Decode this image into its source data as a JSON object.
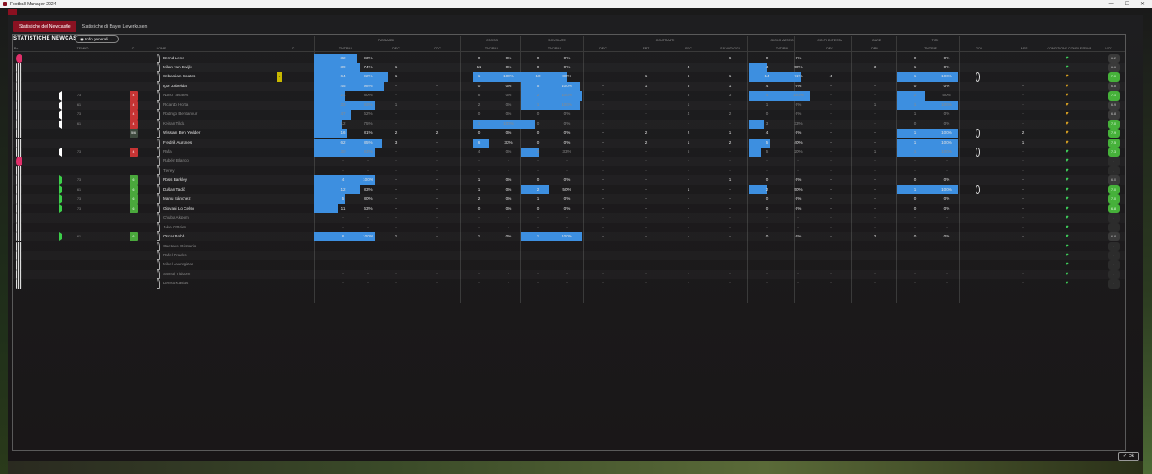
{
  "window": {
    "title": "Football Manager 2024"
  },
  "tabs": [
    {
      "label": "Statistiche del Newcastle",
      "active": true
    },
    {
      "label": "Statistiche di Bayer Leverkusen",
      "active": false
    }
  ],
  "panel": {
    "title": "STATISTICHE NEWCASTLE",
    "view_button": "Info generali"
  },
  "column_groups": {
    "passaggi": "PASSAGGI",
    "cross": "CROSS",
    "scivolate": "SCIVOLATE",
    "contrasti": "CONTRASTI",
    "gioco_aereo": "GIOCO AEREO",
    "colpi_testa": "COLPI DI TESTA",
    "gare": "GARE",
    "tiri": "TIRI"
  },
  "columns": {
    "pos": "Po",
    "tempo": "TEMPO",
    "c_left": "C",
    "nome": "NOME",
    "c_right": "C",
    "pass_tnt": "TNT/RIU",
    "pass_dec": "DEC",
    "pass_occ": "OCC",
    "cross_tnt": "TNT/RIU",
    "sciv_tnt": "TNT/RIU",
    "contr_dec": "DEC",
    "contr_fpt": "FPT",
    "contr_rec": "REC",
    "salvataggi": "SALVATAGGI",
    "aereo_tnt": "TNT/RIU",
    "testa_dec": "DEC",
    "drib": "DRB",
    "tiri_tnt": "TNT/RIF",
    "gol": "GOL",
    "ass": "ASS",
    "condizione": "CONDIZIONE COMPLESSIVA",
    "voto": "VOT"
  },
  "players": [
    {
      "name": "Bernd Leno",
      "gk": true,
      "dim": false,
      "sub": "",
      "min": "",
      "card": "",
      "cardc": "",
      "yel": false,
      "p1": "32",
      "p2": "93%",
      "pb": 28,
      "pdec": "-",
      "pocc": "-",
      "c1": "0",
      "c2": "0%",
      "cb": 0,
      "s1": "0",
      "s2": "0%",
      "sb": 0,
      "tdec": "-",
      "tfpt": "-",
      "trec": "-",
      "salv": "6",
      "a1": "0",
      "a2": "0%",
      "ab": 0,
      "hdec": "-",
      "drb": "-",
      "t1": "0",
      "t2": "0%",
      "tb": 0,
      "gol": "",
      "ass": "-",
      "cond": "green",
      "vot": "6.2",
      "votc": "grey"
    },
    {
      "name": "Milan van Ewijk",
      "gk": false,
      "dim": false,
      "sub": "",
      "min": "",
      "card": "",
      "cardc": "",
      "yel": false,
      "p1": "39",
      "p2": "74%",
      "pb": 30,
      "pdec": "1",
      "pocc": "-",
      "c1": "11",
      "c2": "0%",
      "cb": 0,
      "s1": "0",
      "s2": "0%",
      "sb": 0,
      "tdec": "-",
      "tfpt": "-",
      "trec": "4",
      "salv": "-",
      "a1": "4",
      "a2": "50%",
      "ab": 12,
      "hdec": "-",
      "drb": "3",
      "t1": "1",
      "t2": "0%",
      "tb": 0,
      "gol": "",
      "ass": "-",
      "cond": "green",
      "vot": "6.6",
      "votc": "grey"
    },
    {
      "name": "Sebastian Coates",
      "gk": false,
      "dim": false,
      "sub": "",
      "min": "",
      "card": "",
      "cardc": "",
      "yel": true,
      "p1": "64",
      "p2": "92%",
      "pb": 48,
      "pdec": "1",
      "pocc": "-",
      "c1": "1",
      "c2": "100%",
      "cb": 40,
      "s1": "10",
      "s2": "80%",
      "sb": 30,
      "tdec": "-",
      "tfpt": "1",
      "trec": "6",
      "salv": "1",
      "a1": "14",
      "a2": "71%",
      "ab": 34,
      "hdec": "4",
      "drb": "-",
      "t1": "1",
      "t2": "100%",
      "tb": 40,
      "gol": "1",
      "ass": "-",
      "cond": "orange",
      "vot": "7.0",
      "votc": "green"
    },
    {
      "name": "Igor Zubeldia",
      "gk": false,
      "dim": false,
      "sub": "",
      "min": "",
      "card": "",
      "cardc": "",
      "yel": false,
      "p1": "45",
      "p2": "98%",
      "pb": 46,
      "pdec": "-",
      "pocc": "-",
      "c1": "0",
      "c2": "0%",
      "cb": 0,
      "s1": "5",
      "s2": "100%",
      "sb": 38,
      "tdec": "-",
      "tfpt": "1",
      "trec": "5",
      "salv": "1",
      "a1": "4",
      "a2": "0%",
      "ab": 0,
      "hdec": "-",
      "drb": "-",
      "t1": "0",
      "t2": "0%",
      "tb": 0,
      "gol": "",
      "ass": "-",
      "cond": "orange",
      "vot": "6.8",
      "votc": "grey"
    },
    {
      "name": "Nuno Tavares",
      "gk": false,
      "dim": true,
      "sub": "out",
      "min": "73",
      "card": "4",
      "cardc": "red",
      "yel": false,
      "p1": "21",
      "p2": "80%",
      "pb": 20,
      "pdec": "-",
      "pocc": "-",
      "c1": "8",
      "c2": "0%",
      "cb": 0,
      "s1": "2",
      "s2": "100%",
      "sb": 40,
      "tdec": "-",
      "tfpt": "-",
      "trec": "3",
      "salv": "3",
      "a1": "4",
      "a2": "100%",
      "ab": 40,
      "hdec": "-",
      "drb": "-",
      "t1": "2",
      "t2": "50%",
      "tb": 18,
      "gol": "",
      "ass": "-",
      "cond": "orange",
      "vot": "7.1",
      "votc": "green"
    },
    {
      "name": "Ricardo Horta",
      "gk": false,
      "dim": true,
      "sub": "out",
      "min": "61",
      "card": "4",
      "cardc": "red",
      "yel": false,
      "p1": "33",
      "p2": "93%",
      "pb": 40,
      "pdec": "1",
      "pocc": "-",
      "c1": "2",
      "c2": "0%",
      "cb": 0,
      "s1": "1",
      "s2": "100%",
      "sb": 38,
      "tdec": "-",
      "tfpt": "-",
      "trec": "1",
      "salv": "-",
      "a1": "1",
      "a2": "0%",
      "ab": 0,
      "hdec": "-",
      "drb": "1",
      "t1": "1",
      "t2": "100%",
      "tb": 40,
      "gol": "",
      "ass": "-",
      "cond": "orange",
      "vot": "6.9",
      "votc": "grey"
    },
    {
      "name": "Rodrigo Bentancur",
      "gk": false,
      "dim": true,
      "sub": "out",
      "min": "73",
      "card": "4",
      "cardc": "red",
      "yel": false,
      "p1": "47",
      "p2": "62%",
      "pb": 24,
      "pdec": "-",
      "pocc": "-",
      "c1": "0",
      "c2": "0%",
      "cb": 0,
      "s1": "0",
      "s2": "0%",
      "sb": 0,
      "tdec": "-",
      "tfpt": "-",
      "trec": "4",
      "salv": "2",
      "a1": "0",
      "a2": "0%",
      "ab": 0,
      "hdec": "-",
      "drb": "-",
      "t1": "1",
      "t2": "0%",
      "tb": 0,
      "gol": "",
      "ass": "-",
      "cond": "orange",
      "vot": "6.8",
      "votc": "grey"
    },
    {
      "name": "Keiran Tilda",
      "gk": false,
      "dim": true,
      "sub": "out",
      "min": "61",
      "card": "4",
      "cardc": "red",
      "yel": false,
      "p1": "12",
      "p2": "75%",
      "pb": 18,
      "pdec": "-",
      "pocc": "-",
      "c1": "1",
      "c2": "100%",
      "cb": 40,
      "s1": "0",
      "s2": "0%",
      "sb": 0,
      "tdec": "-",
      "tfpt": "-",
      "trec": "-",
      "salv": "-",
      "a1": "3",
      "a2": "33%",
      "ab": 10,
      "hdec": "-",
      "drb": "-",
      "t1": "0",
      "t2": "0%",
      "tb": 0,
      "gol": "",
      "ass": "-",
      "cond": "orange",
      "vot": "7.0",
      "votc": "green"
    },
    {
      "name": "Wissam Ben Yedder",
      "gk": false,
      "dim": false,
      "sub": "",
      "min": "",
      "card": "5/6",
      "cardc": "grey",
      "yel": false,
      "p1": "16",
      "p2": "81%",
      "pb": 22,
      "pdec": "2",
      "pocc": "2",
      "c1": "0",
      "c2": "0%",
      "cb": 0,
      "s1": "0",
      "s2": "0%",
      "sb": 0,
      "tdec": "-",
      "tfpt": "2",
      "trec": "2",
      "salv": "1",
      "a1": "4",
      "a2": "0%",
      "ab": 0,
      "hdec": "-",
      "drb": "-",
      "t1": "1",
      "t2": "100%",
      "tb": 40,
      "gol": "1",
      "ass": "2",
      "cond": "orange",
      "vot": "7.9",
      "votc": "green"
    },
    {
      "name": "Fredrik Aursnes",
      "gk": false,
      "dim": false,
      "sub": "",
      "min": "",
      "card": "",
      "cardc": "",
      "yel": false,
      "p1": "62",
      "p2": "85%",
      "pb": 44,
      "pdec": "3",
      "pocc": "-",
      "c1": "6",
      "c2": "33%",
      "cb": 10,
      "s1": "0",
      "s2": "0%",
      "sb": 0,
      "tdec": "-",
      "tfpt": "2",
      "trec": "1",
      "salv": "2",
      "a1": "5",
      "a2": "40%",
      "ab": 14,
      "hdec": "-",
      "drb": "-",
      "t1": "1",
      "t2": "100%",
      "tb": 40,
      "gol": "",
      "ass": "1",
      "cond": "orange",
      "vot": "7.5",
      "votc": "green"
    },
    {
      "name": "Rafa",
      "gk": false,
      "dim": true,
      "sub": "out",
      "min": "73",
      "card": "4",
      "cardc": "red",
      "yel": false,
      "p1": "30",
      "p2": "93%",
      "pb": 40,
      "pdec": "-",
      "pocc": "-",
      "c1": "4",
      "c2": "0%",
      "cb": 0,
      "s1": "3",
      "s2": "33%",
      "sb": 12,
      "tdec": "-",
      "tfpt": "-",
      "trec": "6",
      "salv": "-",
      "a1": "5",
      "a2": "20%",
      "ab": 8,
      "hdec": "-",
      "drb": "1",
      "t1": "1",
      "t2": "100%",
      "tb": 40,
      "gol": "1",
      "ass": "-",
      "cond": "green",
      "vot": "7.3",
      "votc": "green"
    },
    {
      "name": "Rubén Blanco",
      "gk": true,
      "dim": true,
      "sub": "",
      "min": "",
      "card": "",
      "cardc": "",
      "yel": false,
      "p1": "-",
      "p2": "-",
      "pb": 0,
      "pdec": "-",
      "pocc": "-",
      "c1": "-",
      "c2": "-",
      "cb": 0,
      "s1": "-",
      "s2": "-",
      "sb": 0,
      "tdec": "-",
      "tfpt": "-",
      "trec": "-",
      "salv": "-",
      "a1": "-",
      "a2": "-",
      "ab": 0,
      "hdec": "-",
      "drb": "-",
      "t1": "-",
      "t2": "-",
      "tb": 0,
      "gol": "",
      "ass": "-",
      "cond": "green",
      "vot": "-",
      "votc": "empty"
    },
    {
      "name": "Tierey",
      "gk": false,
      "dim": true,
      "sub": "",
      "min": "",
      "card": "",
      "cardc": "",
      "yel": false,
      "p1": "-",
      "p2": "-",
      "pb": 0,
      "pdec": "-",
      "pocc": "-",
      "c1": "-",
      "c2": "-",
      "cb": 0,
      "s1": "-",
      "s2": "-",
      "sb": 0,
      "tdec": "-",
      "tfpt": "-",
      "trec": "-",
      "salv": "-",
      "a1": "-",
      "a2": "-",
      "ab": 0,
      "hdec": "-",
      "drb": "-",
      "t1": "-",
      "t2": "-",
      "tb": 0,
      "gol": "",
      "ass": "-",
      "cond": "green",
      "vot": "-",
      "votc": "empty"
    },
    {
      "name": "Ross Barkley",
      "gk": false,
      "dim": false,
      "sub": "in",
      "min": "73",
      "card": "6",
      "cardc": "green",
      "yel": false,
      "p1": "4",
      "p2": "100%",
      "pb": 40,
      "pdec": "-",
      "pocc": "-",
      "c1": "1",
      "c2": "0%",
      "cb": 0,
      "s1": "0",
      "s2": "0%",
      "sb": 0,
      "tdec": "-",
      "tfpt": "-",
      "trec": "-",
      "salv": "1",
      "a1": "0",
      "a2": "0%",
      "ab": 0,
      "hdec": "-",
      "drb": "-",
      "t1": "0",
      "t2": "0%",
      "tb": 0,
      "gol": "",
      "ass": "-",
      "cond": "green",
      "vot": "6.0",
      "votc": "grey"
    },
    {
      "name": "Dušan Tadić",
      "gk": false,
      "dim": false,
      "sub": "in",
      "min": "61",
      "card": "6",
      "cardc": "green",
      "yel": false,
      "p1": "12",
      "p2": "83%",
      "pb": 30,
      "pdec": "-",
      "pocc": "-",
      "c1": "1",
      "c2": "0%",
      "cb": 0,
      "s1": "2",
      "s2": "50%",
      "sb": 18,
      "tdec": "-",
      "tfpt": "-",
      "trec": "1",
      "salv": "-",
      "a1": "2",
      "a2": "50%",
      "ab": 12,
      "hdec": "-",
      "drb": "-",
      "t1": "1",
      "t2": "100%",
      "tb": 40,
      "gol": "1",
      "ass": "-",
      "cond": "green",
      "vot": "7.0",
      "votc": "green"
    },
    {
      "name": "Manu Sánchez",
      "gk": false,
      "dim": false,
      "sub": "in",
      "min": "73",
      "card": "6",
      "cardc": "green",
      "yel": false,
      "p1": "5",
      "p2": "80%",
      "pb": 20,
      "pdec": "-",
      "pocc": "-",
      "c1": "2",
      "c2": "0%",
      "cb": 0,
      "s1": "1",
      "s2": "0%",
      "sb": 0,
      "tdec": "-",
      "tfpt": "-",
      "trec": "-",
      "salv": "-",
      "a1": "0",
      "a2": "0%",
      "ab": 0,
      "hdec": "-",
      "drb": "-",
      "t1": "0",
      "t2": "0%",
      "tb": 0,
      "gol": "",
      "ass": "-",
      "cond": "green",
      "vot": "7.0",
      "votc": "green"
    },
    {
      "name": "Giovani Lo Celso",
      "gk": false,
      "dim": false,
      "sub": "in",
      "min": "73",
      "card": "6",
      "cardc": "green",
      "yel": false,
      "p1": "11",
      "p2": "63%",
      "pb": 16,
      "pdec": "-",
      "pocc": "-",
      "c1": "0",
      "c2": "0%",
      "cb": 0,
      "s1": "0",
      "s2": "0%",
      "sb": 0,
      "tdec": "-",
      "tfpt": "-",
      "trec": "-",
      "salv": "-",
      "a1": "0",
      "a2": "0%",
      "ab": 0,
      "hdec": "-",
      "drb": "-",
      "t1": "0",
      "t2": "0%",
      "tb": 0,
      "gol": "",
      "ass": "-",
      "cond": "green",
      "vot": "6.8",
      "votc": "green"
    },
    {
      "name": "Chuba Akpom",
      "gk": false,
      "dim": true,
      "sub": "",
      "min": "",
      "card": "",
      "cardc": "",
      "yel": false,
      "p1": "-",
      "p2": "-",
      "pb": 0,
      "pdec": "-",
      "pocc": "-",
      "c1": "-",
      "c2": "-",
      "cb": 0,
      "s1": "-",
      "s2": "-",
      "sb": 0,
      "tdec": "-",
      "tfpt": "-",
      "trec": "-",
      "salv": "-",
      "a1": "-",
      "a2": "-",
      "ab": 0,
      "hdec": "-",
      "drb": "-",
      "t1": "-",
      "t2": "-",
      "tb": 0,
      "gol": "",
      "ass": "-",
      "cond": "green",
      "vot": "-",
      "votc": "empty"
    },
    {
      "name": "Jake O'Brien",
      "gk": false,
      "dim": true,
      "sub": "",
      "min": "",
      "card": "",
      "cardc": "",
      "yel": false,
      "p1": "-",
      "p2": "-",
      "pb": 0,
      "pdec": "-",
      "pocc": "-",
      "c1": "-",
      "c2": "-",
      "cb": 0,
      "s1": "-",
      "s2": "-",
      "sb": 0,
      "tdec": "-",
      "tfpt": "-",
      "trec": "-",
      "salv": "-",
      "a1": "-",
      "a2": "-",
      "ab": 0,
      "hdec": "-",
      "drb": "-",
      "t1": "-",
      "t2": "-",
      "tb": 0,
      "gol": "",
      "ass": "-",
      "cond": "green",
      "vot": "-",
      "votc": "empty"
    },
    {
      "name": "Oscar Bobb",
      "gk": false,
      "dim": false,
      "sub": "in",
      "min": "61",
      "card": "6",
      "cardc": "green",
      "yel": false,
      "p1": "6",
      "p2": "100%",
      "pb": 40,
      "pdec": "1",
      "pocc": "-",
      "c1": "1",
      "c2": "0%",
      "cb": 0,
      "s1": "1",
      "s2": "100%",
      "sb": 40,
      "tdec": "-",
      "tfpt": "-",
      "trec": "-",
      "salv": "-",
      "a1": "0",
      "a2": "0%",
      "ab": 0,
      "hdec": "-",
      "drb": "2",
      "t1": "0",
      "t2": "0%",
      "tb": 0,
      "gol": "",
      "ass": "-",
      "cond": "green",
      "vot": "6.8",
      "votc": "grey"
    },
    {
      "name": "Gaetano Oristanio",
      "gk": false,
      "dim": true,
      "sub": "",
      "min": "",
      "card": "",
      "cardc": "",
      "yel": false,
      "p1": "-",
      "p2": "-",
      "pb": 0,
      "pdec": "-",
      "pocc": "-",
      "c1": "-",
      "c2": "-",
      "cb": 0,
      "s1": "-",
      "s2": "-",
      "sb": 0,
      "tdec": "-",
      "tfpt": "-",
      "trec": "-",
      "salv": "-",
      "a1": "-",
      "a2": "-",
      "ab": 0,
      "hdec": "-",
      "drb": "-",
      "t1": "-",
      "t2": "-",
      "tb": 0,
      "gol": "",
      "ass": "-",
      "cond": "green",
      "vot": "-",
      "votc": "empty"
    },
    {
      "name": "Rafel Prados",
      "gk": false,
      "dim": true,
      "sub": "",
      "min": "",
      "card": "",
      "cardc": "",
      "yel": false,
      "p1": "-",
      "p2": "-",
      "pb": 0,
      "pdec": "-",
      "pocc": "-",
      "c1": "-",
      "c2": "-",
      "cb": 0,
      "s1": "-",
      "s2": "-",
      "sb": 0,
      "tdec": "-",
      "tfpt": "-",
      "trec": "-",
      "salv": "-",
      "a1": "-",
      "a2": "-",
      "ab": 0,
      "hdec": "-",
      "drb": "-",
      "t1": "-",
      "t2": "-",
      "tb": 0,
      "gol": "",
      "ass": "-",
      "cond": "green",
      "vot": "-",
      "votc": "empty"
    },
    {
      "name": "Mikel Jauregizar",
      "gk": false,
      "dim": true,
      "sub": "",
      "min": "",
      "card": "",
      "cardc": "",
      "yel": false,
      "p1": "-",
      "p2": "-",
      "pb": 0,
      "pdec": "-",
      "pocc": "-",
      "c1": "-",
      "c2": "-",
      "cb": 0,
      "s1": "-",
      "s2": "-",
      "sb": 0,
      "tdec": "-",
      "tfpt": "-",
      "trec": "-",
      "salv": "-",
      "a1": "-",
      "a2": "-",
      "ab": 0,
      "hdec": "-",
      "drb": "-",
      "t1": "-",
      "t2": "-",
      "tb": 0,
      "gol": "",
      "ass": "-",
      "cond": "green",
      "vot": "-",
      "votc": "empty"
    },
    {
      "name": "Samuij Tiddom",
      "gk": false,
      "dim": true,
      "sub": "",
      "min": "",
      "card": "",
      "cardc": "",
      "yel": false,
      "p1": "-",
      "p2": "-",
      "pb": 0,
      "pdec": "-",
      "pocc": "-",
      "c1": "-",
      "c2": "-",
      "cb": 0,
      "s1": "-",
      "s2": "-",
      "sb": 0,
      "tdec": "-",
      "tfpt": "-",
      "trec": "-",
      "salv": "-",
      "a1": "-",
      "a2": "-",
      "ab": 0,
      "hdec": "-",
      "drb": "-",
      "t1": "-",
      "t2": "-",
      "tb": 0,
      "gol": "",
      "ass": "-",
      "cond": "green",
      "vot": "-",
      "votc": "empty"
    },
    {
      "name": "Denso Kasius",
      "gk": false,
      "dim": true,
      "sub": "",
      "min": "",
      "card": "",
      "cardc": "",
      "yel": false,
      "p1": "-",
      "p2": "-",
      "pb": 0,
      "pdec": "-",
      "pocc": "-",
      "c1": "-",
      "c2": "-",
      "cb": 0,
      "s1": "-",
      "s2": "-",
      "sb": 0,
      "tdec": "-",
      "tfpt": "-",
      "trec": "-",
      "salv": "-",
      "a1": "-",
      "a2": "-",
      "ab": 0,
      "hdec": "-",
      "drb": "-",
      "t1": "-",
      "t2": "-",
      "tb": 0,
      "gol": "",
      "ass": "-",
      "cond": "green",
      "vot": "-",
      "votc": "empty"
    }
  ],
  "footer": {
    "ok_label": "Ok"
  }
}
